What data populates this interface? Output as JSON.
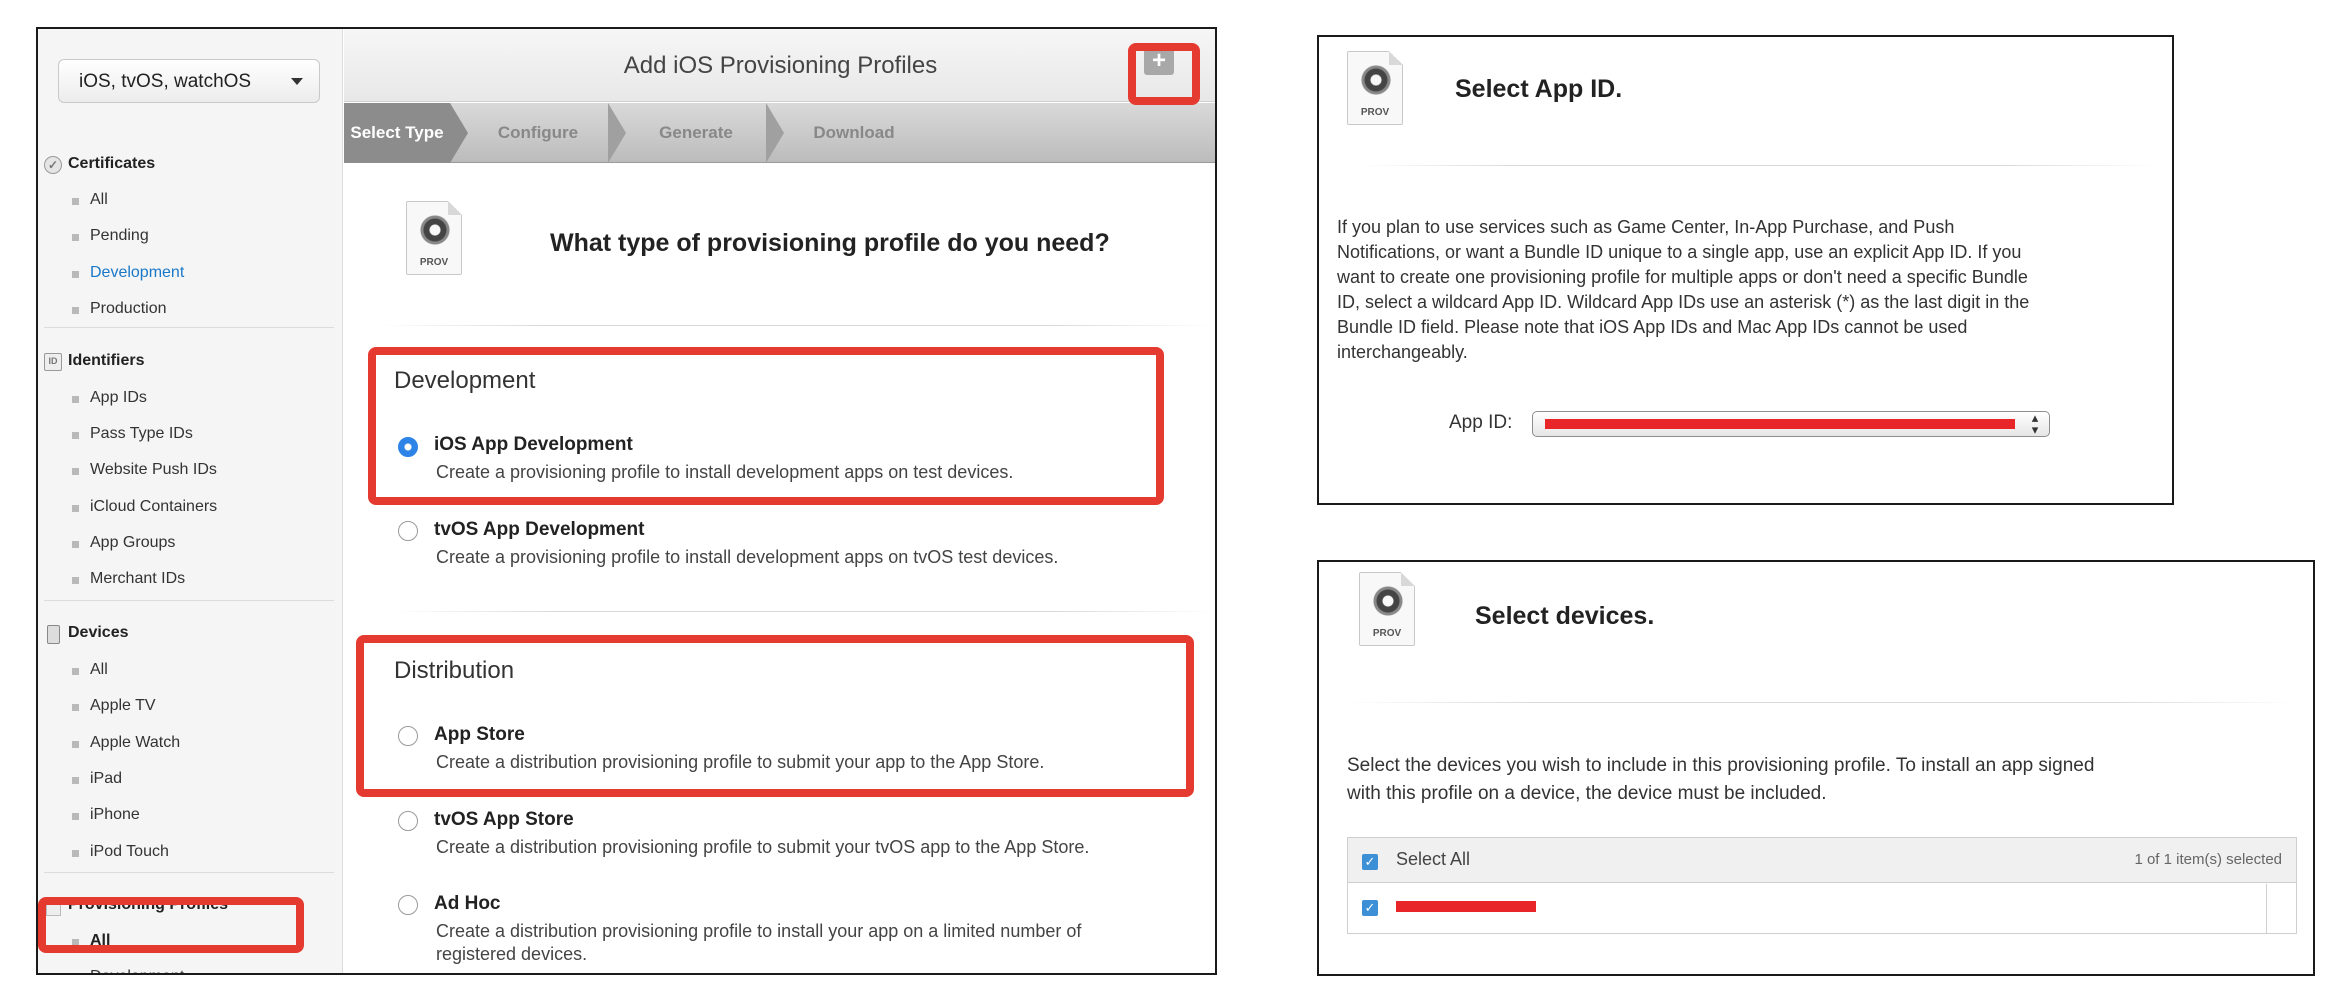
{
  "left": {
    "platform": "iOS, tvOS, watchOS",
    "sidebar": {
      "certificates": {
        "title": "Certificates",
        "items": [
          "All",
          "Pending",
          "Development",
          "Production"
        ]
      },
      "identifiers": {
        "title": "Identifiers",
        "icon_text": "ID",
        "items": [
          "App IDs",
          "Pass Type IDs",
          "Website Push IDs",
          "iCloud Containers",
          "App Groups",
          "Merchant IDs"
        ]
      },
      "devices": {
        "title": "Devices",
        "items": [
          "All",
          "Apple TV",
          "Apple Watch",
          "iPad",
          "iPhone",
          "iPod Touch"
        ]
      },
      "provisioning": {
        "title": "Provisioning Profiles",
        "items": [
          "All",
          "Development"
        ]
      }
    },
    "header": {
      "title": "Add iOS Provisioning Profiles",
      "plus": "+"
    },
    "steps": [
      "Select Type",
      "Configure",
      "Generate",
      "Download"
    ],
    "prov_label": "PROV",
    "question": "What type of provisioning profile do you need?",
    "development": {
      "heading": "Development",
      "options": [
        {
          "title": "iOS App Development",
          "desc": "Create a provisioning profile to install development apps on test devices.",
          "checked": true
        },
        {
          "title": "tvOS App Development",
          "desc": "Create a provisioning profile to install development apps on tvOS test devices.",
          "checked": false
        }
      ]
    },
    "distribution": {
      "heading": "Distribution",
      "options": [
        {
          "title": "App Store",
          "desc": "Create a distribution provisioning profile to submit your app to the App Store."
        },
        {
          "title": "tvOS App Store",
          "desc": "Create a distribution provisioning profile to submit your tvOS app to the App Store."
        },
        {
          "title": "Ad Hoc",
          "desc_line1": "Create a distribution provisioning profile to install your app on a limited number of",
          "desc_line2": "registered devices."
        }
      ]
    }
  },
  "appid_panel": {
    "prov_label": "PROV",
    "title": "Select App ID.",
    "body": [
      "If you plan to use services such as Game Center, In-App Purchase, and Push",
      "Notifications, or want a Bundle ID unique to a single app, use an explicit App ID. If you",
      "want to create one provisioning profile for multiple apps or don't need a specific Bundle",
      "ID, select a wildcard App ID. Wildcard App IDs use an asterisk (*) as the last digit in the",
      "Bundle ID field. Please note that iOS App IDs and Mac App IDs cannot be used",
      "interchangeably."
    ],
    "field_label": "App ID:"
  },
  "devices_panel": {
    "prov_label": "PROV",
    "title": "Select devices.",
    "body": [
      "Select the devices you wish to include in this provisioning profile. To install an app signed",
      "with this profile on a device, the device must be included."
    ],
    "select_all": "Select All",
    "selected_count": "1  of 1 item(s) selected"
  },
  "colors": {
    "highlight": "#e53a2f",
    "accent": "#2d84e6",
    "link": "#1a78c8"
  }
}
